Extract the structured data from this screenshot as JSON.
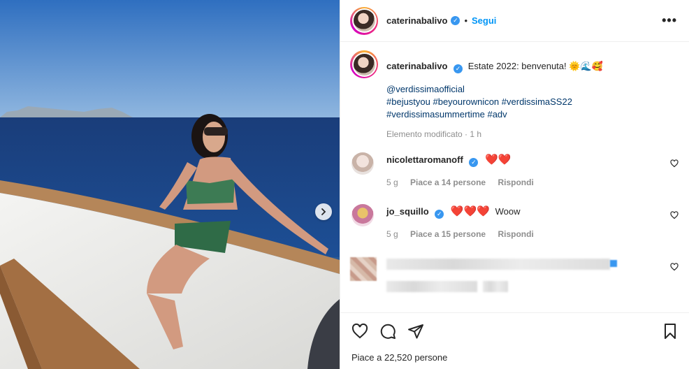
{
  "post": {
    "author": "caterinabalivo",
    "follow_label": "Segui",
    "more_label": "•••"
  },
  "caption": {
    "author": "caterinabalivo",
    "text": "Estate 2022: benvenuta!",
    "emojis": "🌞🌊🥰",
    "mention": "@verdissimaofficial",
    "hashtags_line1": "#bejustyou #beyourownicon #verdissimaSS22",
    "hashtags_line2": "#verdissimasummertime #adv",
    "meta": "Elemento modificato · 1 h"
  },
  "comments": [
    {
      "author": "nicolettaromanoff",
      "text": "❤️❤️",
      "time": "5 g",
      "likes": "Piace a 14 persone",
      "reply": "Rispondi"
    },
    {
      "author": "jo_squillo",
      "text": "Woow",
      "hearts": "❤️❤️❤️",
      "time": "5 g",
      "likes": "Piace a 15 persone",
      "reply": "Rispondi"
    }
  ],
  "footer": {
    "likes_label": "Piace a 22,520 persone"
  },
  "colors": {
    "accent": "#0095f6",
    "verified": "#3897f0",
    "heart": "#ed4956",
    "muted": "#8e8e8e"
  },
  "icons": [
    "verified-icon",
    "more-options-icon",
    "heart-icon",
    "comment-icon",
    "share-icon",
    "save-icon",
    "chevron-right-icon"
  ]
}
